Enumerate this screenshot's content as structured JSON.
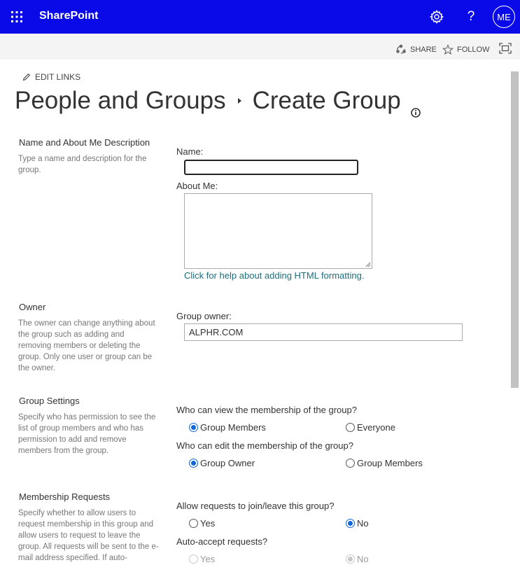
{
  "suite_bar": {
    "app_name": "SharePoint",
    "avatar_initials": "ME",
    "help_glyph": "?",
    "bg_color": "#0a0ae8",
    "icons": [
      "waffle-icon",
      "gear-icon",
      "help-icon"
    ]
  },
  "action_bar": {
    "share_label": "SHARE",
    "follow_label": "FOLLOW"
  },
  "edit_links_label": "EDIT LINKS",
  "breadcrumb": {
    "parent": "People and Groups",
    "current": "Create Group"
  },
  "sections": {
    "name": {
      "title": "Name and About Me Description",
      "description": "Type a name and description for the group.",
      "name_label": "Name:",
      "name_value": "",
      "about_label": "About Me:",
      "about_value": "",
      "help_link": "Click for help about adding HTML formatting."
    },
    "owner": {
      "title": "Owner",
      "description": "The owner can change anything about the group such as adding and removing members or deleting the group. Only one user or group can be the owner.",
      "field_label": "Group owner:",
      "field_value": "ALPHR.COM"
    },
    "settings": {
      "title": "Group Settings",
      "description": "Specify who has permission to see the list of group members and who has permission to add and remove members from the group.",
      "view_question": "Who can view the membership of the group?",
      "view_options": [
        "Group Members",
        "Everyone"
      ],
      "view_selected": "Group Members",
      "edit_question": "Who can edit the membership of the group?",
      "edit_options": [
        "Group Owner",
        "Group Members"
      ],
      "edit_selected": "Group Owner"
    },
    "membership": {
      "title": "Membership Requests",
      "description": "Specify whether to allow users to request membership in this group and allow users to request to leave the group. All requests will be sent to the e-mail address specified. If auto-",
      "allow_question": "Allow requests to join/leave this group?",
      "allow_options": [
        "Yes",
        "No"
      ],
      "allow_selected": "No",
      "auto_question": "Auto-accept requests?",
      "auto_options": [
        "Yes",
        "No"
      ],
      "auto_selected": "No",
      "auto_disabled": true
    }
  }
}
